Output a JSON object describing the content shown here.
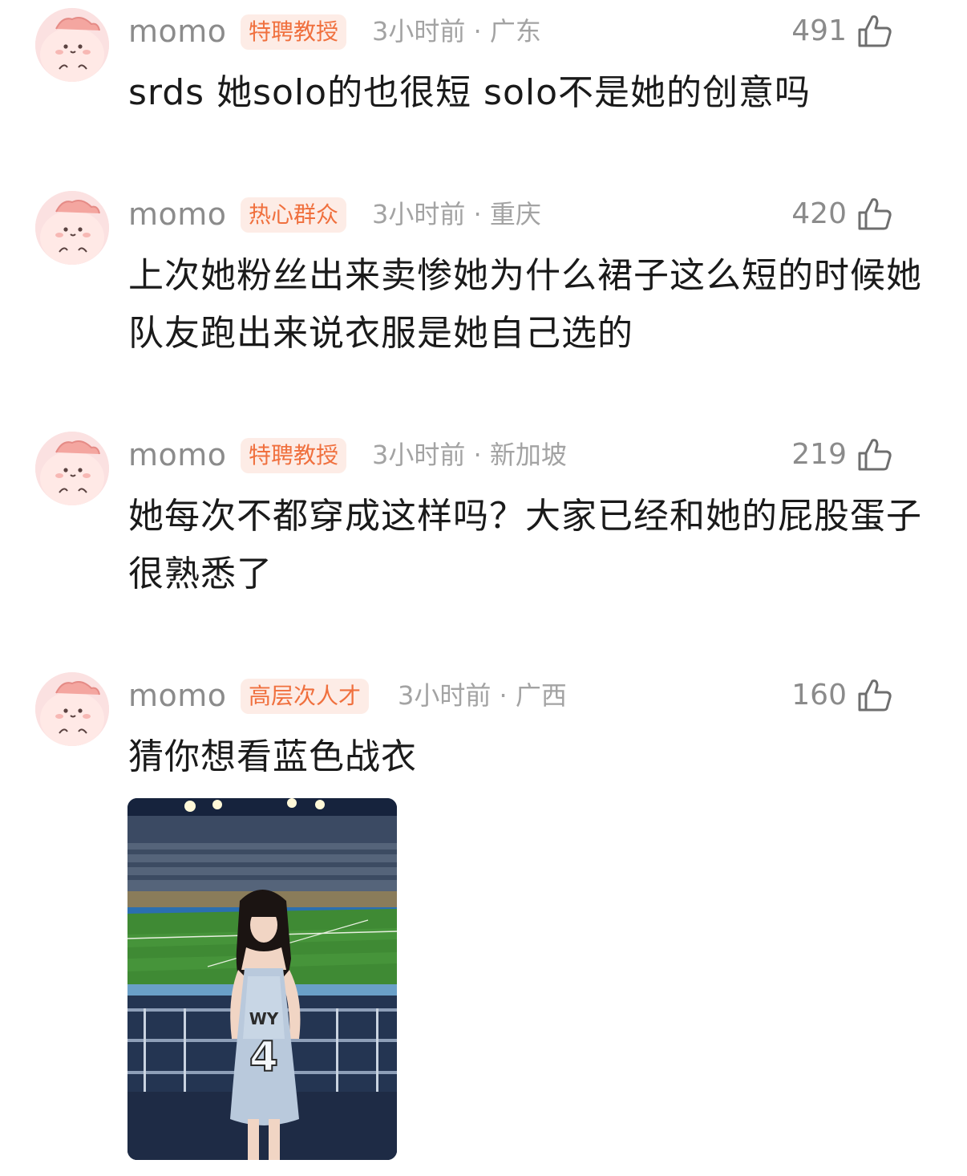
{
  "comments": [
    {
      "username": "momo",
      "badge": "特聘教授",
      "meta": "3小时前 · 广东",
      "likes": "491",
      "text": "srds 她solo的也很短 solo不是她的创意吗"
    },
    {
      "username": "momo",
      "badge": "热心群众",
      "meta": "3小时前 · 重庆",
      "likes": "420",
      "text": "上次她粉丝出来卖惨她为什么裙子这么短的时候她队友跑出来说衣服是她自己选的"
    },
    {
      "username": "momo",
      "badge": "特聘教授",
      "meta": "3小时前 · 新加坡",
      "likes": "219",
      "text": "她每次不都穿成这样吗？大家已经和她的屁股蛋子很熟悉了"
    },
    {
      "username": "momo",
      "badge": "高层次人才",
      "meta": "3小时前 · 广西",
      "likes": "160",
      "text": "猜你想看蓝色战衣",
      "photo": {
        "jersey_text": "WY",
        "jersey_number": "4"
      }
    }
  ],
  "colors": {
    "badge_text": "#f0703e",
    "badge_bg": "#fdece6",
    "meta": "#a3a3a3",
    "username": "#8b8b8b",
    "body_text": "#1a1a1a"
  },
  "icons": {
    "avatar": "pink-cartoon-avatar-icon",
    "like": "thumb-up-icon"
  }
}
